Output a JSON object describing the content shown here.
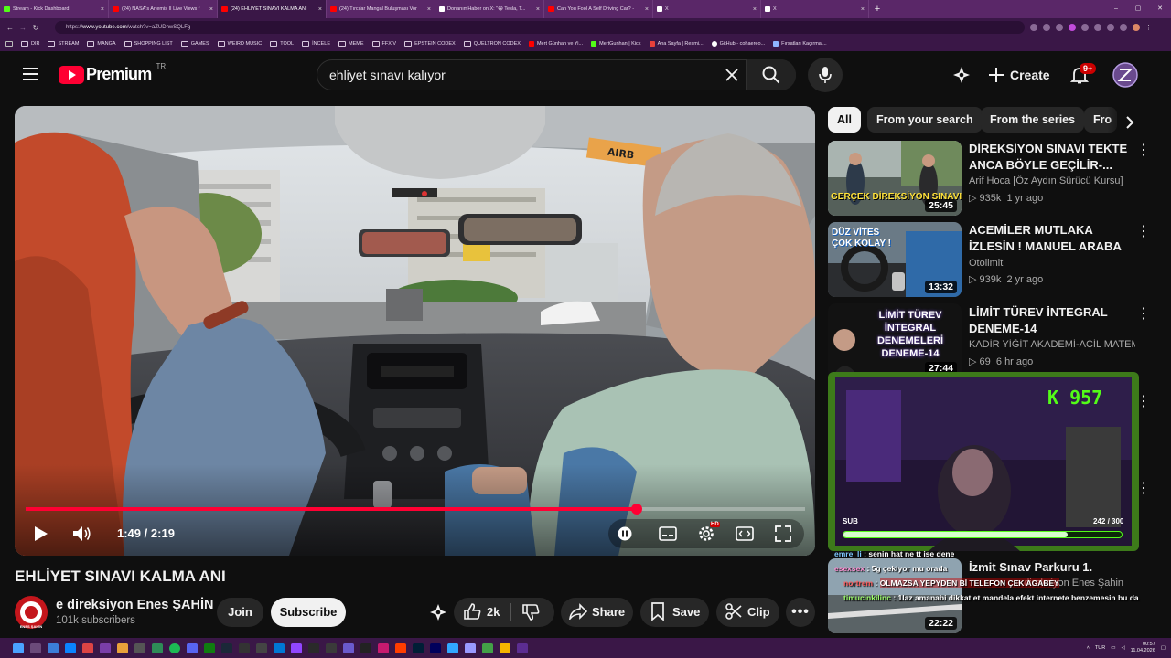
{
  "browser": {
    "tabs": [
      {
        "title": "Stream - Kick Dashboard",
        "favicon_color": "#53fc18",
        "active": false
      },
      {
        "title": "(24) NASA's Artemis II Live Views f",
        "favicon_color": "#ff0000",
        "active": false
      },
      {
        "title": "(24) EHLİYET SINAVI KALMA ANI",
        "favicon_color": "#ff0000",
        "active": true
      },
      {
        "title": "(24) Tırcılar Mangal Buluşması Vor",
        "favicon_color": "#ff0000",
        "active": false
      },
      {
        "title": "DonanımHaber on X: \"😁 Tesla, T...",
        "favicon_color": "#ffffff",
        "active": false
      },
      {
        "title": "Can You Fool A Self Driving Car? -",
        "favicon_color": "#ff0000",
        "active": false
      },
      {
        "title": "X",
        "favicon_color": "#ffffff",
        "active": false
      },
      {
        "title": "X",
        "favicon_color": "#ffffff",
        "active": false
      }
    ],
    "tab_close": "×",
    "new_tab": "+",
    "window_controls": [
      "–",
      "▢",
      "✕"
    ],
    "url_prefix": "https://",
    "url_host": "www.youtube.com",
    "url_path": "/watch?v=aZUDhwSQLFg",
    "bookmarks": [
      {
        "label": "DIR",
        "type": "folder"
      },
      {
        "label": "STREAM",
        "type": "folder"
      },
      {
        "label": "MANGA",
        "type": "folder"
      },
      {
        "label": "SHOPPING LIST",
        "type": "folder"
      },
      {
        "label": "GAMES",
        "type": "folder"
      },
      {
        "label": "WEIRD MUSIC",
        "type": "folder"
      },
      {
        "label": "TOOL",
        "type": "folder"
      },
      {
        "label": "İNCELE",
        "type": "folder"
      },
      {
        "label": "MEME",
        "type": "folder"
      },
      {
        "label": "FFXIV",
        "type": "folder"
      },
      {
        "label": "EPSTEIN CODEX",
        "type": "folder"
      },
      {
        "label": "QUELTRON CODEX",
        "type": "folder"
      },
      {
        "label": "Mert Günhan ve Yi...",
        "type": "site",
        "color": "#ff0000"
      },
      {
        "label": "MertGunhan | Kick",
        "type": "site",
        "color": "#53fc18"
      },
      {
        "label": "Ana Sayfa | Resmi...",
        "type": "site",
        "color": "#e8403a"
      },
      {
        "label": "GitHub - cohaereo...",
        "type": "site",
        "color": "#ffffff"
      },
      {
        "label": "Fırsatları Kaçırmal...",
        "type": "site",
        "color": "#8fb4ff"
      }
    ]
  },
  "youtube": {
    "logo_text": "Premium",
    "logo_region": "TR",
    "search_query": "ehliyet sınavı kalıyor",
    "create_label": "Create",
    "notifications_badge": "9+",
    "chips": [
      "All",
      "From your search",
      "From the series",
      "Fro"
    ],
    "player": {
      "time_current": "1:49",
      "time_separator": "/",
      "time_total": "2:19",
      "progress_fraction": 0.784,
      "settings_badge": "HD",
      "sticker_airbag": "AIRB"
    },
    "video": {
      "title": "EHLİYET SINAVI KALMA ANI",
      "channel_name": "e direksiyon Enes ŞAHİN",
      "avatar_text": "ENES ŞAHİN",
      "subscribers": "101k subscribers",
      "join_label": "Join",
      "subscribe_label": "Subscribe",
      "likes": "2k",
      "share_label": "Share",
      "save_label": "Save",
      "clip_label": "Clip"
    },
    "related": [
      {
        "title": "DİREKSİYON SINAVI TEKTE ANCA BÖYLE GEÇİLİR-...",
        "channel": "Arif Hoca [Öz Aydın Sürücü Kursu]",
        "views": "935k",
        "age": "1 yr ago",
        "duration": "25:45",
        "thumb_text": "GERÇEK DİREKSİYON SINAVI"
      },
      {
        "title": "ACEMİLER MUTLAKA İZLESİN ! MANUEL ARABA KULLANMA ...",
        "channel": "Otolimit",
        "views": "939k",
        "age": "2 yr ago",
        "duration": "13:32",
        "thumb_text": "DÜZ VİTES ÇOK KOLAY !"
      },
      {
        "title": "LİMİT TÜREV İNTEGRAL DENEME-14",
        "channel": "KADİR YİĞİT AKADEMİ-ACİL MATEMATİK",
        "views": "69",
        "age": "6 hr ago",
        "duration": "27:44",
        "thumb_text": "LİMİT TÜREV İNTEGRAL DENEMELERİ DENEME-14"
      },
      {
        "title": "İzmit Sınav Parkuru 1. Güzergah",
        "channel": "e direksiyon Enes Şahin",
        "views": "",
        "age": "",
        "duration": "22:22",
        "thumb_text": ""
      }
    ],
    "stream_overlay": {
      "sub_count": "957",
      "sub_label": "SUB",
      "goal_text": "242 / 300",
      "goal_fraction": 0.807,
      "chat": [
        {
          "user": "emre_li",
          "text": "senin hat ne tt ise dene",
          "color": "#7ec8ff"
        },
        {
          "user": "esexsex",
          "text": "5g çekiyor mu orada",
          "color": "#ff8fd2"
        },
        {
          "user": "nortrem",
          "text": "OLMAZSA YEPYDEN Bİ TELEFON ÇEK AGABEY",
          "color": "#ff5c5c"
        },
        {
          "user": "timucinkilinc",
          "text": "1laz amanabi dikkat et mandela efekt internete benzemesin bu da",
          "color": "#9cff6a"
        }
      ]
    }
  },
  "taskbar": {
    "tray_lang": "TUR",
    "time": "00:57",
    "date": "11.04.2026"
  },
  "colors": {
    "accent_red": "#ff0033",
    "browser_purple": "#5a2768",
    "browser_dark": "#3a1747",
    "yt_bg": "#0f0f0f",
    "kick_green": "#53fc18"
  }
}
